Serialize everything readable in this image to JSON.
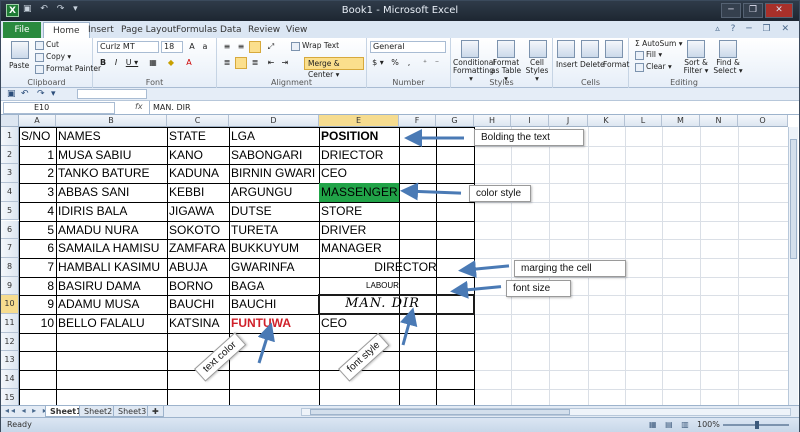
{
  "window": {
    "title": "Book1 - Microsoft Excel",
    "app_icon": "X",
    "qat_icons": [
      "save-icon",
      "undo-icon",
      "redo-icon"
    ],
    "buttons": [
      "minimize",
      "restore",
      "close"
    ]
  },
  "tabs": [
    "File",
    "Home",
    "Insert",
    "Page Layout",
    "Formulas",
    "Data",
    "Review",
    "View"
  ],
  "active_tab": "Home",
  "ribbon": {
    "clipboard": {
      "label": "Clipboard",
      "paste": "Paste",
      "cut": "Cut",
      "copy": "Copy ▾",
      "format_painter": "Format Painter"
    },
    "font": {
      "label": "Font",
      "name": "Curlz MT",
      "size": "18",
      "bold": "B",
      "italic": "I",
      "underline": "U ▾"
    },
    "alignment": {
      "label": "Alignment",
      "wrap_text": "Wrap Text",
      "merge_center": "Merge & Center ▾"
    },
    "number": {
      "label": "Number",
      "format": "General",
      "currency": "$ ▾",
      "percent": "%",
      "comma": ","
    },
    "styles": {
      "label": "Styles",
      "conditional": "Conditional Formatting ▾",
      "format_table": "Format as Table ▾",
      "cell_styles": "Cell Styles ▾"
    },
    "cells": {
      "label": "Cells",
      "insert": "Insert",
      "delete": "Delete",
      "format": "Format"
    },
    "editing": {
      "label": "Editing",
      "autosum": "AutoSum ▾",
      "fill": "Fill ▾",
      "clear": "Clear ▾",
      "sort": "Sort & Filter ▾",
      "find": "Find & Select ▾"
    }
  },
  "formula_bar": {
    "name_box": "E10",
    "fx": "fx",
    "value": "MAN. DIR"
  },
  "columns": [
    "A",
    "B",
    "C",
    "D",
    "E",
    "F",
    "G",
    "H",
    "I",
    "J",
    "K",
    "L",
    "M",
    "N",
    "O"
  ],
  "rows": [
    "1",
    "2",
    "3",
    "4",
    "5",
    "6",
    "7",
    "8",
    "9",
    "10",
    "11",
    "12",
    "13",
    "14",
    "15"
  ],
  "table": {
    "headers": [
      "S/NO",
      "NAMES",
      "STATE",
      "LGA",
      "POSITION"
    ],
    "records": [
      [
        "1",
        "MUSA SABIU",
        "KANO",
        "SABONGARI",
        "DRIECTOR"
      ],
      [
        "2",
        "TANKO BATURE",
        "KADUNA",
        "BIRNIN GWARI",
        "CEO"
      ],
      [
        "3",
        "ABBAS SANI",
        "KEBBI",
        "ARGUNGU",
        "MASSENGER"
      ],
      [
        "4",
        "IDIRIS BALA",
        "JIGAWA",
        "DUTSE",
        "STORE"
      ],
      [
        "5",
        "AMADU NURA",
        "SOKOTO",
        "TURETA",
        "DRIVER"
      ],
      [
        "6",
        "SAMAILA HAMISU",
        "ZAMFARA",
        "BUKKUYUM",
        "MANAGER"
      ],
      [
        "7",
        "HAMBALI KASIMU",
        "ABUJA",
        "GWARINFA",
        "DIRECTOR"
      ],
      [
        "8",
        "BASIRU DAMA",
        "BORNO",
        "BAGA",
        "LABOUR"
      ],
      [
        "9",
        "ADAMU MUSA",
        "BAUCHI",
        "BAUCHI",
        "MAN. DIR"
      ],
      [
        "10",
        "BELLO FALALU",
        "KATSINA",
        "FUNTUWA",
        "CEO"
      ]
    ]
  },
  "colors": {
    "green_fill": "#21a348",
    "red_text": "#d0202a",
    "arrow": "#4a7ab5",
    "file_tab": "#2a8a3e"
  },
  "annotations": {
    "bolding": "Bolding the text",
    "color_style": "color style",
    "marging": "marging the cell",
    "font_size": "font size",
    "text_color": "text color",
    "font_style": "font style"
  },
  "sheets": [
    "Sheet1",
    "Sheet2",
    "Sheet3"
  ],
  "active_sheet": "Sheet1",
  "status": {
    "ready": "Ready",
    "zoom": "100%"
  }
}
